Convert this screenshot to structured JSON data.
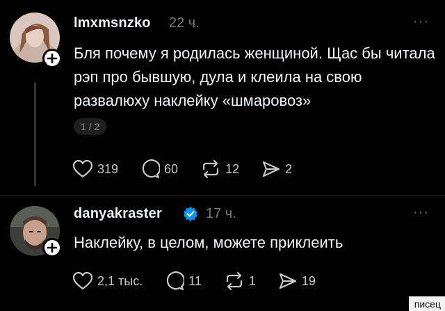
{
  "posts": [
    {
      "username": "lmxmsnzko",
      "time": "22 ч.",
      "more": "···",
      "text": "Бля почему я родилась женщиной. Щас бы читала рэп про бывшую, дула и клеила на свою развалюху наклейку «шмаровоз»",
      "page_indicator": "1 / 2",
      "verified": false,
      "stats": {
        "likes": "319",
        "comments": "60",
        "reposts": "12",
        "shares": "2"
      }
    },
    {
      "username": "danyakraster",
      "time": "17 ч.",
      "more": "···",
      "text": "Наклейку, в целом, можете приклеить",
      "verified": true,
      "stats": {
        "likes": "2,1 тыс.",
        "comments": "11",
        "reposts": "1",
        "shares": "19"
      }
    }
  ],
  "icons": {
    "like": "heart-icon",
    "comment": "comment-bubble-icon",
    "repost": "repost-icon",
    "share": "share-paper-plane-icon",
    "follow": "plus-icon",
    "verified": "verified-badge-icon"
  },
  "colors": {
    "background": "#000000",
    "text": "#f3f5f7",
    "muted": "#777777",
    "verified": "#0095f6"
  },
  "watermark": "писец"
}
